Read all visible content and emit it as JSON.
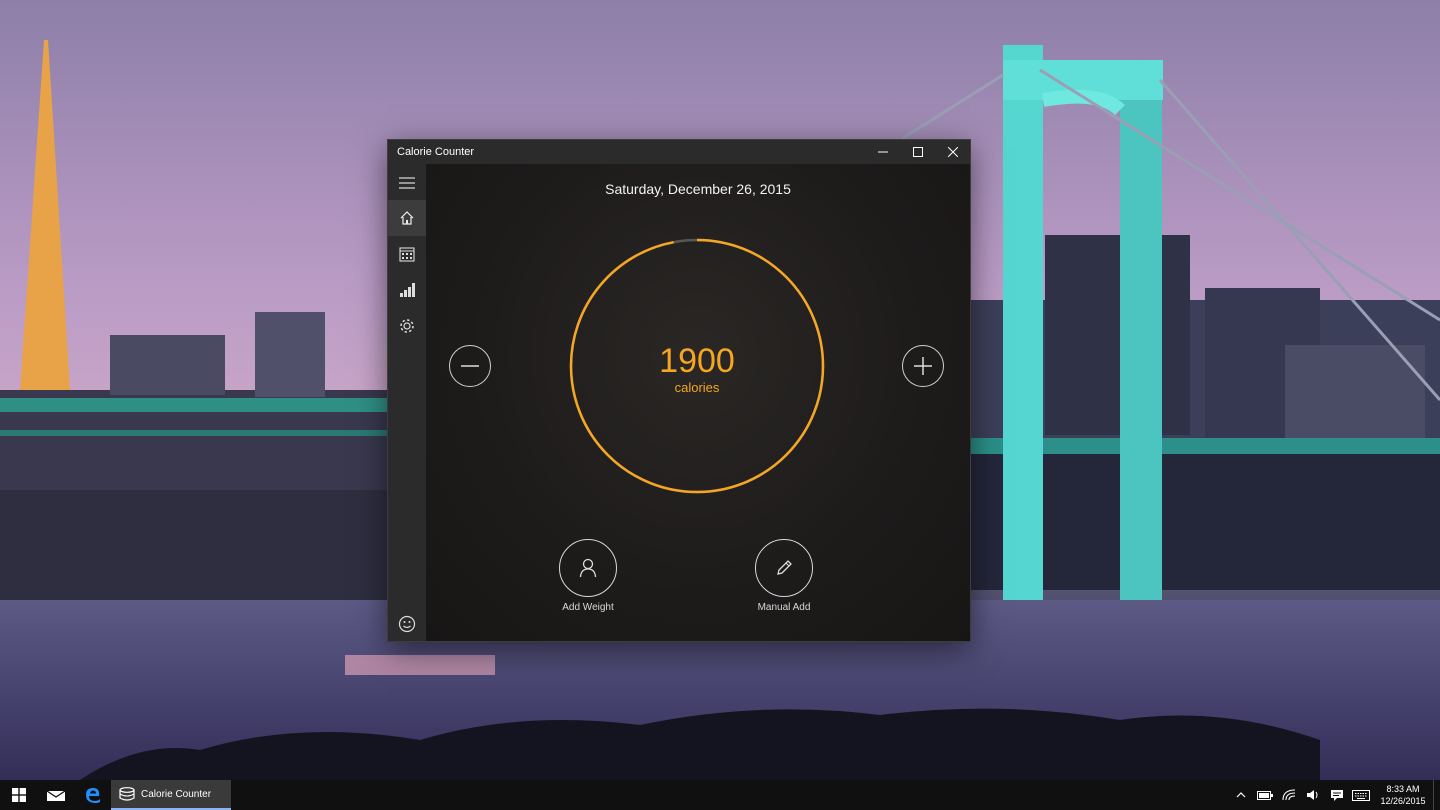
{
  "window": {
    "title": "Calorie Counter",
    "controls": {
      "minimize": "minimize",
      "maximize": "maximize",
      "close": "close"
    }
  },
  "nav": {
    "items": [
      {
        "icon": "hamburger-menu-icon",
        "active": false
      },
      {
        "icon": "home-icon",
        "active": true
      },
      {
        "icon": "calendar-icon",
        "active": false
      },
      {
        "icon": "bar-chart-icon",
        "active": false
      },
      {
        "icon": "gear-icon",
        "active": false
      },
      {
        "icon": "smiley-icon",
        "active": false
      }
    ]
  },
  "main": {
    "date": "Saturday, December 26, 2015",
    "calories_value": "1900",
    "calories_unit": "calories",
    "ring_progress": 0.97,
    "actions": {
      "add_weight": "Add Weight",
      "manual_add": "Manual Add"
    }
  },
  "taskbar": {
    "app_label": "Calorie Counter",
    "time": "8:33 AM",
    "date": "12/26/2015"
  },
  "colors": {
    "accent": "#f5a623",
    "window_bg": "#1a1817",
    "rail_bg": "#2b2b2b"
  }
}
